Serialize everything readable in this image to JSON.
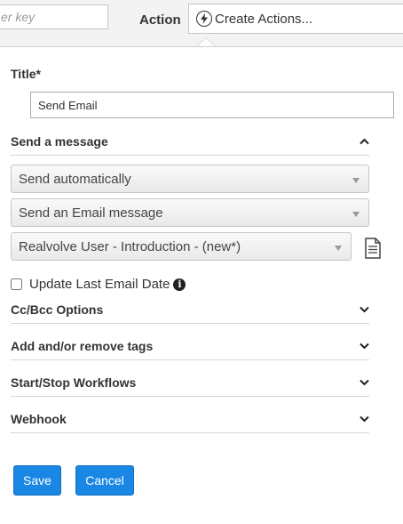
{
  "topbar": {
    "key_placeholder": "er key",
    "action_label": "Action",
    "action_value": "Create Actions..."
  },
  "form": {
    "title_label": "Title*",
    "title_value": "Send Email",
    "send_section": {
      "label": "Send a message",
      "expanded": true,
      "send_mode": "Send automatically",
      "message_type": "Send an Email message",
      "template": "Realvolve User - Introduction - (new*)"
    },
    "checkbox": {
      "label": "Update Last Email Date",
      "checked": false
    },
    "sections": [
      {
        "label": "Cc/Bcc Options",
        "expanded": false
      },
      {
        "label": "Add and/or remove tags",
        "expanded": false
      },
      {
        "label": "Start/Stop Workflows",
        "expanded": false
      },
      {
        "label": "Webhook",
        "expanded": false
      }
    ]
  },
  "buttons": {
    "save": "Save",
    "cancel": "Cancel"
  },
  "colors": {
    "primary_button": "#1b87e5",
    "topbar_bg": "#f3f3f3"
  },
  "icons": [
    "lightning-bolt-icon",
    "chevron-up-icon",
    "chevron-down-icon",
    "document-icon",
    "info-icon"
  ]
}
